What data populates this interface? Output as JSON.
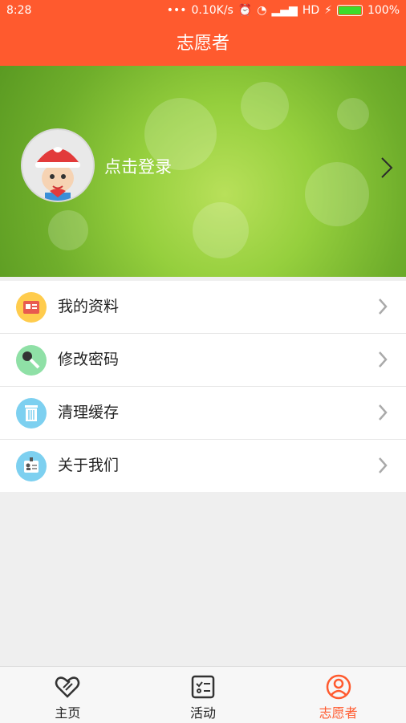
{
  "status": {
    "time": "8:28",
    "speed": "0.10K/s",
    "network": "HD",
    "battery": "100%"
  },
  "header": {
    "title": "志愿者"
  },
  "profile": {
    "login_label": "点击登录"
  },
  "menu": [
    {
      "label": "我的资料",
      "icon": "profile-card-icon",
      "color": "#ffcc4d"
    },
    {
      "label": "修改密码",
      "icon": "key-icon",
      "color": "#8fe0a6"
    },
    {
      "label": "清理缓存",
      "icon": "trash-icon",
      "color": "#7dd0f0"
    },
    {
      "label": "关于我们",
      "icon": "id-badge-icon",
      "color": "#7dd0f0"
    }
  ],
  "tabs": [
    {
      "label": "主页",
      "icon": "heart-hand-icon",
      "active": false
    },
    {
      "label": "活动",
      "icon": "checklist-icon",
      "active": false
    },
    {
      "label": "志愿者",
      "icon": "user-circle-icon",
      "active": true
    }
  ],
  "colors": {
    "accent": "#ff5a2e"
  }
}
